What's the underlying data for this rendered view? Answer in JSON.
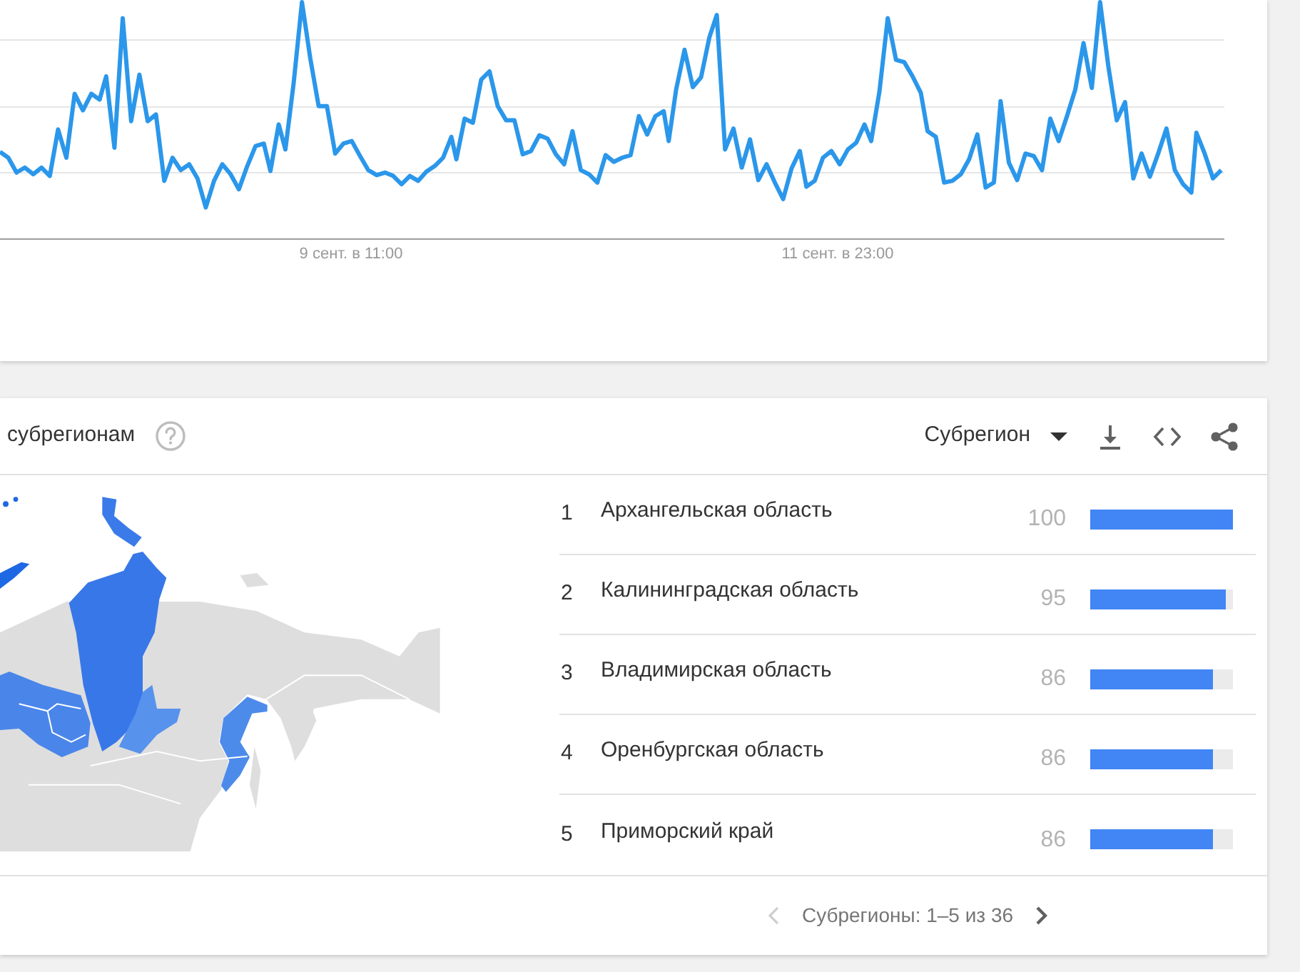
{
  "trend_chart": {
    "x_labels": [
      "9 сент. в 11:00",
      "11 сент. в 23:00"
    ]
  },
  "regions_panel": {
    "title": "субрегионам",
    "dropdown": "Субрегион",
    "rows": [
      {
        "rank": "1",
        "name": "Архангельская область",
        "value": "100",
        "level": 1.0
      },
      {
        "rank": "2",
        "name": "Калининградская область",
        "value": "95",
        "level": 0.95
      },
      {
        "rank": "3",
        "name": "Владимирская область",
        "value": "86",
        "level": 0.86
      },
      {
        "rank": "4",
        "name": "Оренбургская область",
        "value": "86",
        "level": 0.86
      },
      {
        "rank": "5",
        "name": "Приморский край",
        "value": "86",
        "level": 0.86
      }
    ],
    "pagination": {
      "text": "Субрегионы: 1–5 из 36",
      "prev_disabled": true,
      "next_disabled": false
    }
  }
}
